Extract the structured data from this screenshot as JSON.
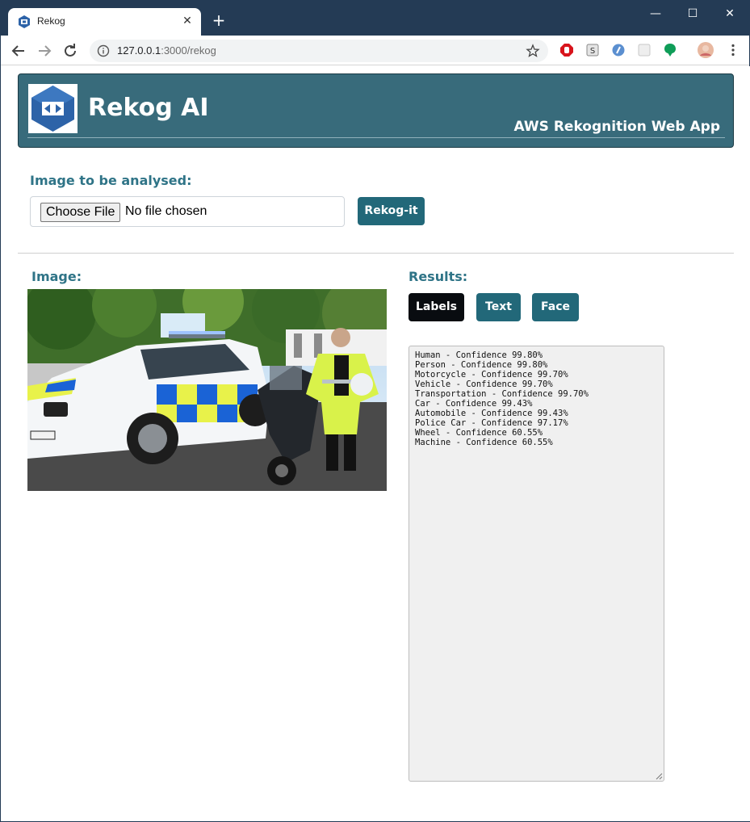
{
  "browser": {
    "tab_title": "Rekog",
    "url_host": "127.0.0.1",
    "url_path": ":3000/rekog"
  },
  "header": {
    "brand": "Rekog AI",
    "subtitle": "AWS Rekognition Web App"
  },
  "upload": {
    "label": "Image to be analysed:",
    "choose_label": "Choose File",
    "file_status": "No file chosen",
    "submit_label": "Rekog-it"
  },
  "image_panel": {
    "label": "Image:"
  },
  "results_panel": {
    "label": "Results:",
    "tabs": [
      {
        "label": "Labels",
        "active": true
      },
      {
        "label": "Text",
        "active": false
      },
      {
        "label": "Face",
        "active": false
      }
    ],
    "lines": [
      "Human - Confidence 99.80%",
      "Person - Confidence 99.80%",
      "Motorcycle - Confidence 99.70%",
      "Vehicle - Confidence 99.70%",
      "Transportation - Confidence 99.70%",
      "Car - Confidence 99.43%",
      "Automobile - Confidence 99.43%",
      "Police Car - Confidence 97.17%",
      "Wheel - Confidence 60.55%",
      "Machine - Confidence 60.55%"
    ]
  },
  "colors": {
    "header_bg": "#386b7b",
    "accent": "#2f7487",
    "button": "#226879",
    "button_active": "#090c10"
  }
}
